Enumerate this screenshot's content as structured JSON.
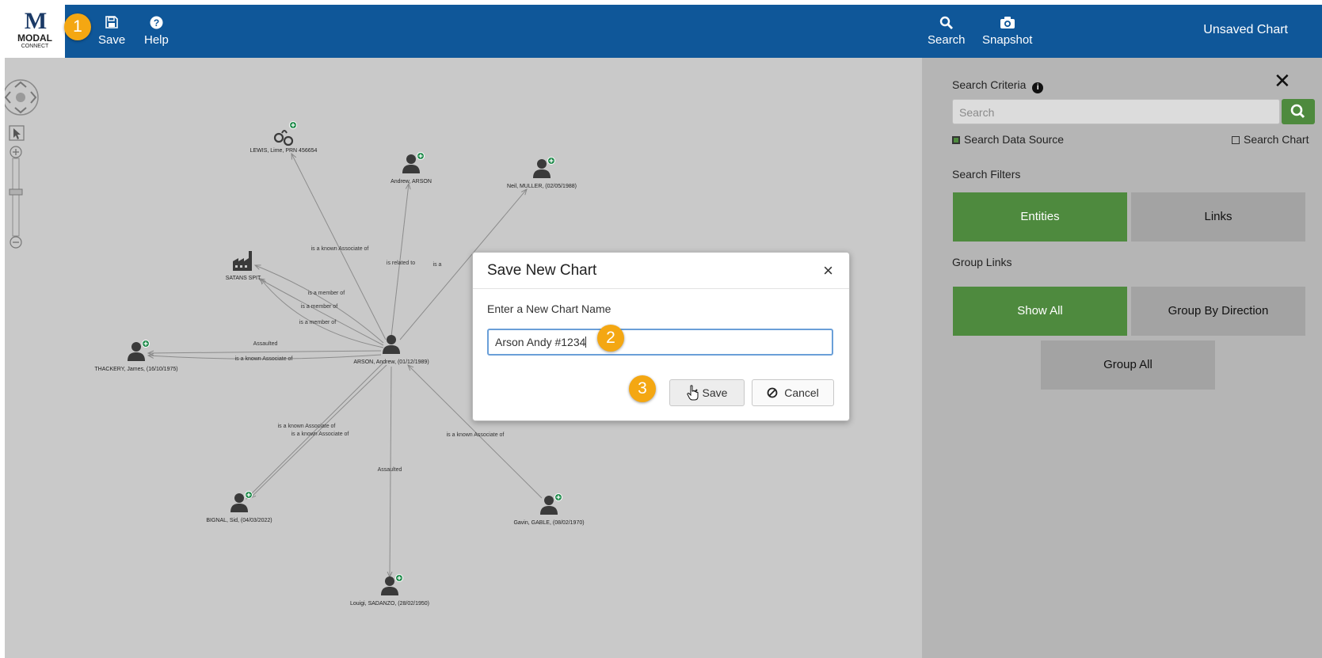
{
  "topbar": {
    "logo": {
      "mark": "M",
      "line1": "MODAL",
      "line2": "CONNECT"
    },
    "save_label": "Save",
    "help_label": "Help",
    "search_label": "Search",
    "snapshot_label": "Snapshot",
    "chart_title": "Unsaved Chart",
    "color": "#0f5799"
  },
  "steps": [
    "1",
    "2",
    "3"
  ],
  "panel": {
    "criteria_label": "Search Criteria",
    "search_placeholder": "Search",
    "search_data_source": "Search Data Source",
    "search_data_source_checked": true,
    "search_chart": "Search Chart",
    "search_chart_checked": false,
    "filters_label": "Search Filters",
    "entities": "Entities",
    "links": "Links",
    "active_filter": "Entities",
    "group_links_label": "Group Links",
    "show_all": "Show All",
    "group_by_direction": "Group By Direction",
    "group_all": "Group All",
    "accent_color": "#4e8a3e"
  },
  "graph": {
    "nodes": [
      {
        "id": "arson",
        "label": "ARSON, Andrew, (01/12/1989)",
        "icon": "person-icon",
        "plus": false
      },
      {
        "id": "lewis",
        "label": "LEWIS, Lime, PRN 456654",
        "icon": "handcuffs-icon",
        "plus": true
      },
      {
        "id": "andrew",
        "label": "Andrew, ARSON",
        "icon": "person-icon",
        "plus": true
      },
      {
        "id": "neil",
        "label": "Neil, MULLER, (02/05/1988)",
        "icon": "person-icon",
        "plus": true
      },
      {
        "id": "satans",
        "label": "SATANS SPIT",
        "icon": "factory-icon",
        "plus": false
      },
      {
        "id": "thackery",
        "label": "THACKERY, James, (16/10/1975)",
        "icon": "person-icon",
        "plus": true
      },
      {
        "id": "bignal",
        "label": "BIGNAL, Sid, (04/03/2022)",
        "icon": "person-icon",
        "plus": true
      },
      {
        "id": "gavin",
        "label": "Gavin, GABLE, (08/02/1970)",
        "icon": "person-icon",
        "plus": true
      },
      {
        "id": "louigi",
        "label": "Louigi, SADANZO, (28/02/1950)",
        "icon": "person-icon",
        "plus": true
      }
    ],
    "links": [
      {
        "from": "arson",
        "to": "lewis",
        "label": "is a known Associate of"
      },
      {
        "from": "arson",
        "to": "andrew",
        "label": "is related to"
      },
      {
        "from": "arson",
        "to": "neil",
        "label": "is a"
      },
      {
        "from": "arson",
        "to": "satans",
        "label": "is a member of"
      },
      {
        "from": "arson",
        "to": "satans",
        "label": "is a member of"
      },
      {
        "from": "arson",
        "to": "satans",
        "label": "is a member of"
      },
      {
        "from": "arson",
        "to": "thackery",
        "label": "Assaulted"
      },
      {
        "from": "arson",
        "to": "thackery",
        "label": "is a known Associate of"
      },
      {
        "from": "arson",
        "to": "bignal",
        "label": "is a known Associate of"
      },
      {
        "from": "arson",
        "to": "bignal",
        "label": "is a known Associate of"
      },
      {
        "from": "arson",
        "to": "louigi",
        "label": "Assaulted"
      },
      {
        "from": "gavin",
        "to": "arson",
        "label": "is a known Associate of"
      }
    ]
  },
  "modal": {
    "title": "Save New Chart",
    "close": "×",
    "field_label": "Enter a New Chart Name",
    "value": "Arson Andy #1234",
    "save": "Save",
    "cancel": "Cancel"
  }
}
